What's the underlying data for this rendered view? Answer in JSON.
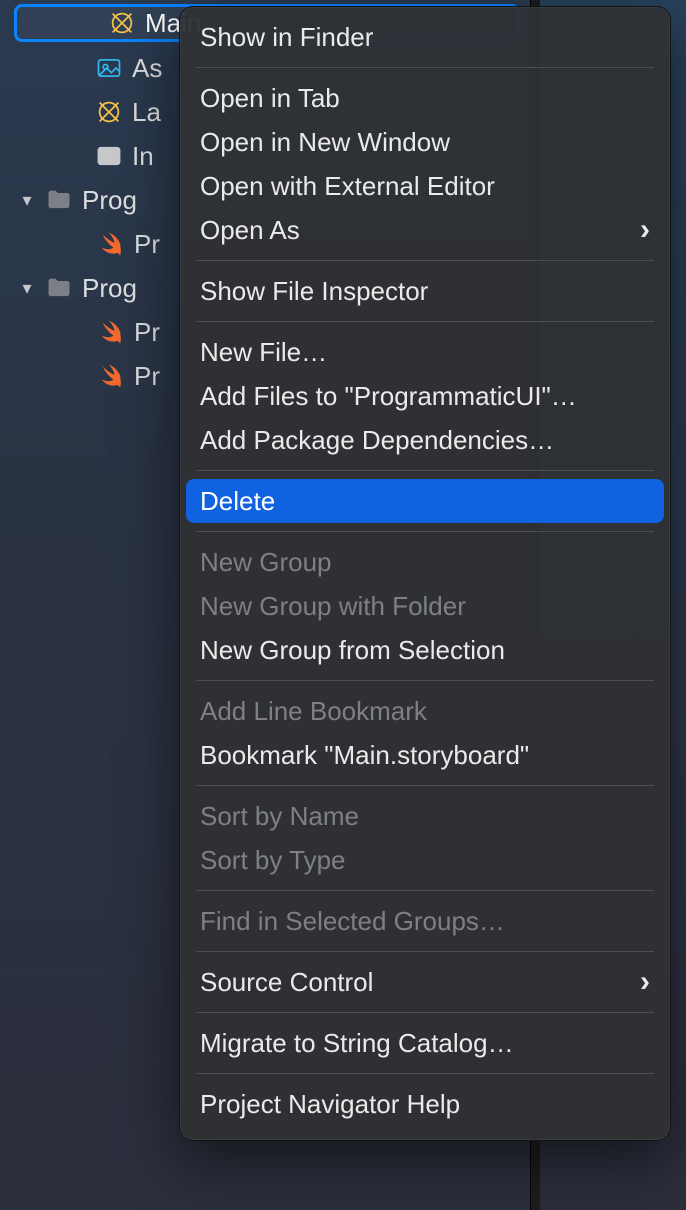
{
  "navigator": {
    "selected_file": "Main",
    "rows": [
      {
        "label": "As",
        "icon": "assets-icon"
      },
      {
        "label": "La",
        "icon": "storyboard-icon"
      },
      {
        "label": "In",
        "icon": "table-icon"
      }
    ],
    "group1": {
      "label": "Prog",
      "children": [
        {
          "label": "Pr",
          "icon": "swift-icon"
        }
      ]
    },
    "group2": {
      "label": "Prog",
      "children": [
        {
          "label": "Pr",
          "icon": "swift-icon"
        },
        {
          "label": "Pr",
          "icon": "swift-icon"
        }
      ]
    }
  },
  "context_menu": {
    "groups": [
      [
        {
          "label": "Show in Finder",
          "enabled": true
        }
      ],
      [
        {
          "label": "Open in Tab",
          "enabled": true
        },
        {
          "label": "Open in New Window",
          "enabled": true
        },
        {
          "label": "Open with External Editor",
          "enabled": true
        },
        {
          "label": "Open As",
          "enabled": true,
          "submenu": true
        }
      ],
      [
        {
          "label": "Show File Inspector",
          "enabled": true
        }
      ],
      [
        {
          "label": "New File…",
          "enabled": true
        },
        {
          "label": "Add Files to \"ProgrammaticUI\"…",
          "enabled": true
        },
        {
          "label": "Add Package Dependencies…",
          "enabled": true
        }
      ],
      [
        {
          "label": "Delete",
          "enabled": true,
          "highlighted": true
        }
      ],
      [
        {
          "label": "New Group",
          "enabled": false
        },
        {
          "label": "New Group with Folder",
          "enabled": false
        },
        {
          "label": "New Group from Selection",
          "enabled": true
        }
      ],
      [
        {
          "label": "Add Line Bookmark",
          "enabled": false
        },
        {
          "label": "Bookmark \"Main.storyboard\"",
          "enabled": true
        }
      ],
      [
        {
          "label": "Sort by Name",
          "enabled": false
        },
        {
          "label": "Sort by Type",
          "enabled": false
        }
      ],
      [
        {
          "label": "Find in Selected Groups…",
          "enabled": false
        }
      ],
      [
        {
          "label": "Source Control",
          "enabled": true,
          "submenu": true
        }
      ],
      [
        {
          "label": "Migrate to String Catalog…",
          "enabled": true
        }
      ],
      [
        {
          "label": "Project Navigator Help",
          "enabled": true
        }
      ]
    ]
  }
}
